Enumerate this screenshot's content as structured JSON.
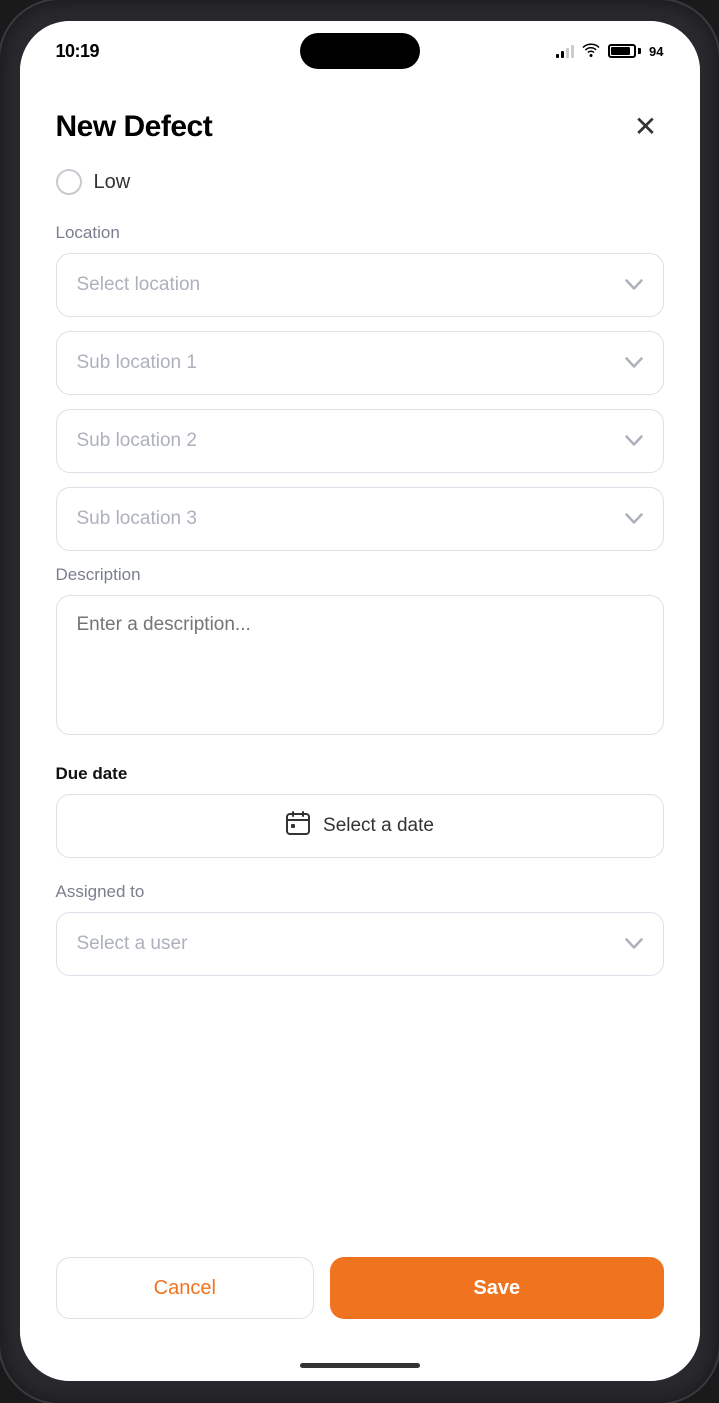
{
  "status_bar": {
    "time": "10:19",
    "battery_pct": "94"
  },
  "header": {
    "title": "New Defect",
    "close_label": "×"
  },
  "priority": {
    "label": "Low"
  },
  "location_section": {
    "label": "Location",
    "select_placeholder": "Select location",
    "sub1_placeholder": "Sub location 1",
    "sub2_placeholder": "Sub location 2",
    "sub3_placeholder": "Sub location 3"
  },
  "description_section": {
    "label": "Description",
    "placeholder": "Enter a description..."
  },
  "due_date_section": {
    "label": "Due date",
    "placeholder": "Select a date"
  },
  "assigned_section": {
    "label": "Assigned to",
    "placeholder": "Select a user"
  },
  "actions": {
    "cancel_label": "Cancel",
    "save_label": "Save"
  }
}
